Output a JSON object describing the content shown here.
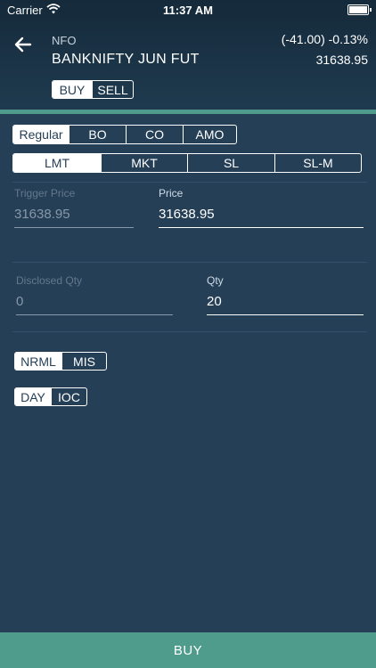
{
  "status_bar": {
    "carrier": "Carrier",
    "time": "11:37 AM"
  },
  "instrument": {
    "exchange": "NFO",
    "symbol": "BANKNIFTY JUN FUT",
    "change": "(-41.00) -0.13%",
    "ltp": "31638.95"
  },
  "side_toggle": {
    "buy": "BUY",
    "sell": "SELL",
    "selected": "BUY"
  },
  "variety": [
    "Regular",
    "BO",
    "CO",
    "AMO"
  ],
  "order_type": [
    "LMT",
    "MKT",
    "SL",
    "SL-M"
  ],
  "fields": {
    "trigger_price": {
      "label": "Trigger Price",
      "value": "31638.95"
    },
    "price": {
      "label": "Price",
      "value": "31638.95"
    },
    "disclosed_qty": {
      "label": "Disclosed Qty",
      "value": "0"
    },
    "qty": {
      "label": "Qty",
      "value": "20"
    }
  },
  "product": [
    "NRML",
    "MIS"
  ],
  "validity": [
    "DAY",
    "IOC"
  ],
  "submit": {
    "label": "BUY"
  },
  "colors": {
    "background": "#253f57",
    "accent": "#4f9c8c",
    "header": "#1b3447"
  }
}
